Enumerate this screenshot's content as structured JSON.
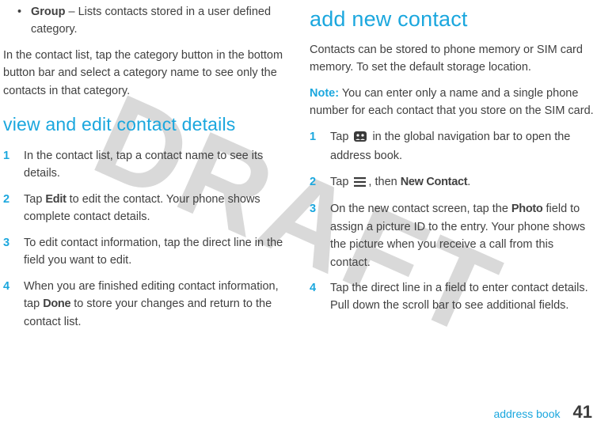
{
  "watermark": "DRAFT",
  "left": {
    "bullet_label": "Group",
    "bullet_rest": " – Lists contacts stored in a user defined category.",
    "para1": "In the contact list, tap the category button in the bottom button bar and select a category name to see only the contacts in that category.",
    "section1": "view and edit contact details",
    "steps": [
      "In the contact list, tap a contact name to see its details.",
      "",
      "To edit contact information, tap the direct line in the field you want to edit.",
      ""
    ],
    "step2_a": "Tap ",
    "step2_b": "Edit",
    "step2_c": " to edit the contact. Your phone shows complete contact details.",
    "step4_a": "When you are finished editing contact information, tap ",
    "step4_b": "Done",
    "step4_c": " to store your changes and return to the contact list."
  },
  "right": {
    "section1": "add new contact",
    "para1": "Contacts can be stored to phone memory or SIM card memory. To set the default storage location.",
    "note_label": "Note:",
    "note_body": " You can enter only a name and a single phone number for each contact that you store on the SIM card.",
    "step1_a": "Tap ",
    "step1_b": " in the global navigation bar to open the address book.",
    "step2_a": "Tap ",
    "step2_b": ", then ",
    "step2_c": "New Contact",
    "step2_d": ".",
    "step3_a": "On the new contact screen, tap the ",
    "step3_b": "Photo",
    "step3_c": " field to assign a picture ID to the entry. Your phone shows the picture when you receive a call from this contact.",
    "step4": "Tap the direct line in a field to enter contact details. Pull down the scroll bar to see additional fields."
  },
  "footer": {
    "label": "address book",
    "page": "41"
  }
}
